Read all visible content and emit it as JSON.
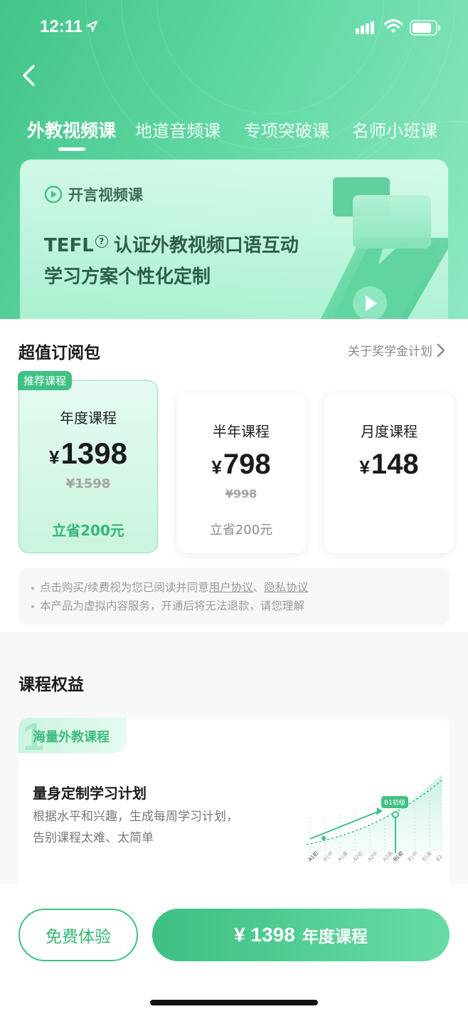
{
  "status_bar": {
    "time": "12:11"
  },
  "tabs": [
    {
      "label": "外教视频课",
      "active": true
    },
    {
      "label": "地道音频课",
      "active": false
    },
    {
      "label": "专项突破课",
      "active": false
    },
    {
      "label": "名师小班课",
      "active": false
    }
  ],
  "banner": {
    "tag": "开言视频课",
    "line1_prefix": "TEFL",
    "line1_mark": "?",
    "line1_suffix": "认证外教视频口语互动",
    "line2": "学习方案个性化定制"
  },
  "subscription": {
    "title": "超值订阅包",
    "scholarship_link": "关于奖学金计划",
    "plans": [
      {
        "badge": "推荐课程",
        "name": "年度课程",
        "currency": "¥",
        "price": "1398",
        "original": "¥1598",
        "save": "立省200元"
      },
      {
        "name": "半年课程",
        "currency": "¥",
        "price": "798",
        "original": "¥998",
        "save": "立省200元"
      },
      {
        "name": "月度课程",
        "currency": "¥",
        "price": "148"
      }
    ]
  },
  "notice": {
    "line1_text": "点击购买/续费视为您已阅读并同意",
    "user_agreement": "用户协议",
    "separator": "、",
    "privacy_agreement": "隐私协议",
    "line2": "本产品为虚拟内容服务，开通后将无法退款，请您理解"
  },
  "benefits": {
    "title": "课程权益",
    "card": {
      "tab_num": "1",
      "tab_label": "海量外教课程",
      "title": "量身定制学习计划",
      "desc": "根据水平和兴趣，生成每周学习计划，告别课程太难、太简单",
      "chart_badge": "B1初级",
      "chart_levels": [
        "A1初",
        "A1中",
        "A1高",
        "A2初",
        "A2中",
        "A2高",
        "B1初",
        "B1中",
        "B1高",
        "B2"
      ]
    }
  },
  "bottom": {
    "trial_label": "免费体验",
    "buy_price": "¥ 1398",
    "buy_plan": "年度课程"
  },
  "colors": {
    "brand_green": "#3fc184",
    "header_start": "#43c489",
    "header_end": "#8de8c3"
  }
}
